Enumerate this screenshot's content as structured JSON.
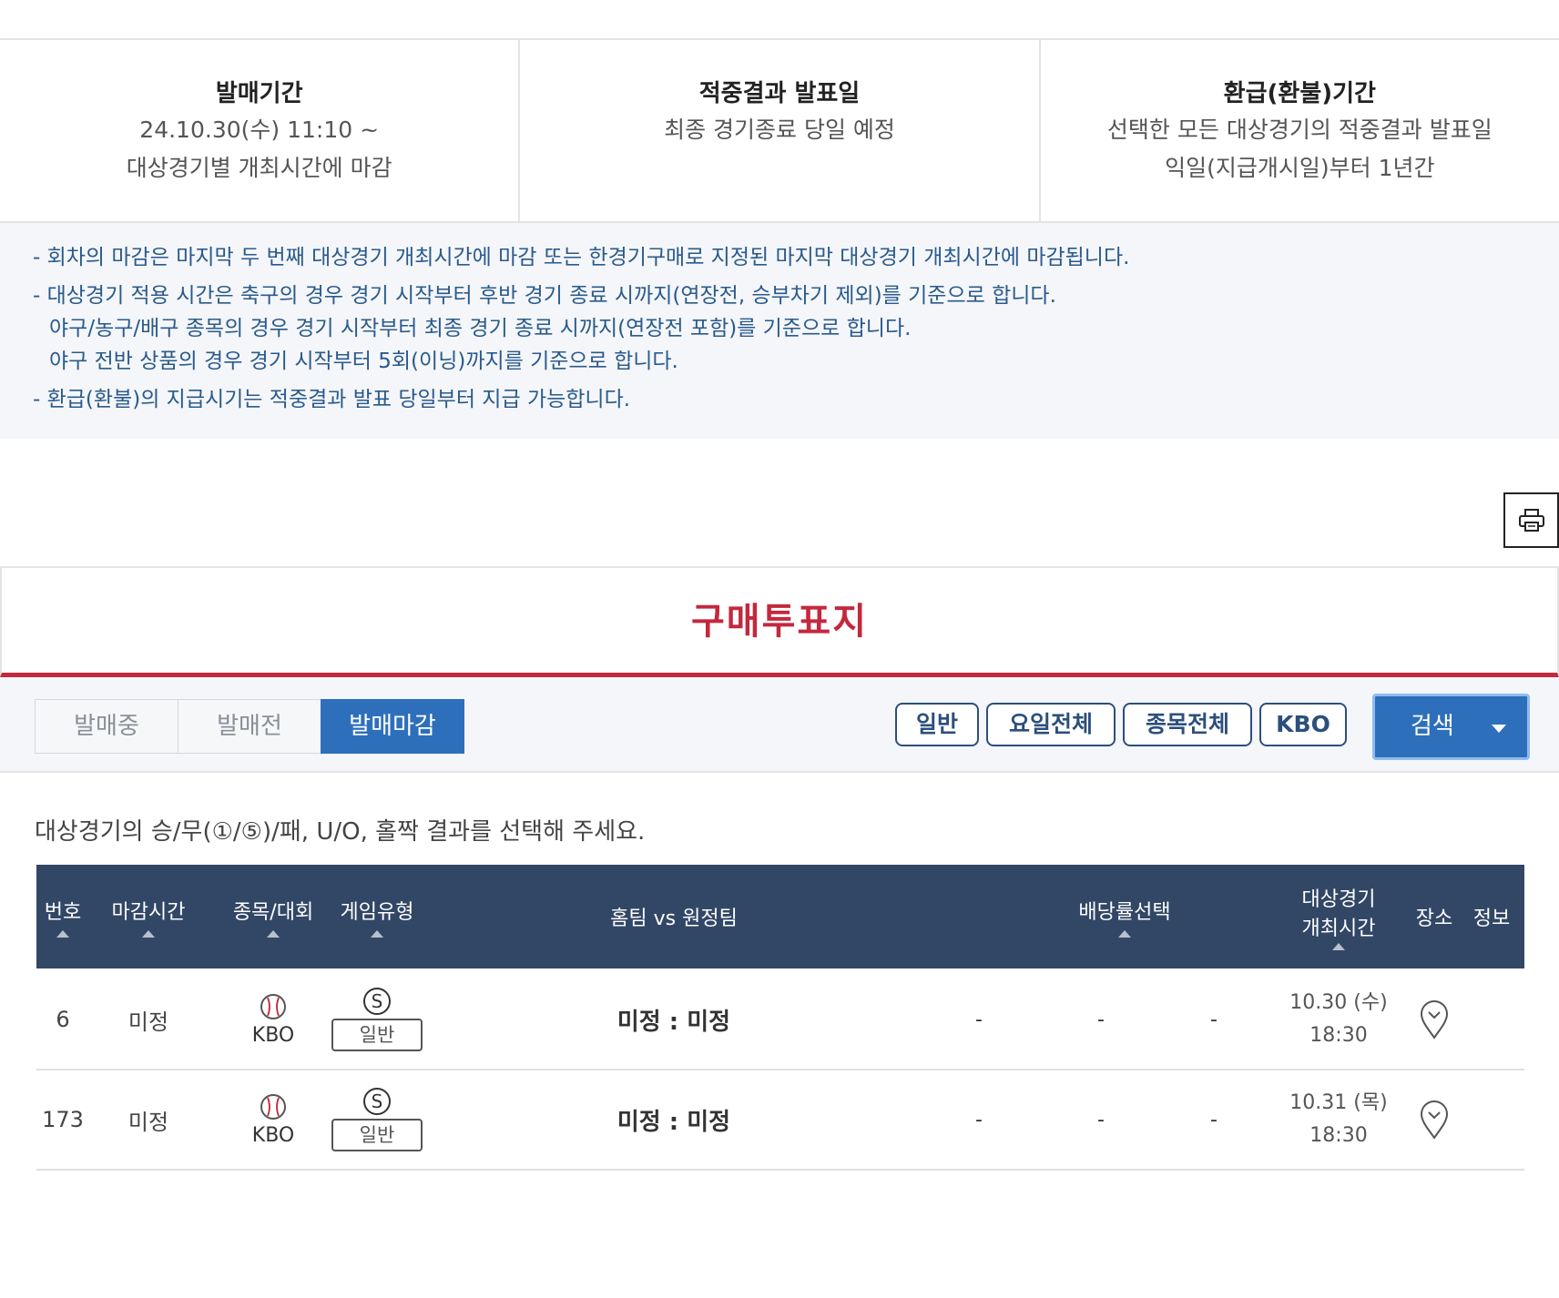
{
  "info": [
    {
      "title": "발매기간",
      "lines": [
        "24.10.30(수) 11:10 ~",
        "대상경기별 개최시간에 마감"
      ]
    },
    {
      "title": "적중결과 발표일",
      "lines": [
        "최종 경기종료 당일 예정"
      ]
    },
    {
      "title": "환급(환불)기간",
      "lines": [
        "선택한 모든 대상경기의 적중결과 발표일",
        "익일(지급개시일)부터 1년간"
      ]
    }
  ],
  "notes": [
    "- 회차의 마감은 마지막 두 번째 대상경기 개최시간에 마감 또는 한경기구매로 지정된 마지막 대상경기 개최시간에 마감됩니다.",
    "- 대상경기 적용 시간은 축구의 경우 경기 시작부터 후반 경기 종료 시까지(연장전, 승부차기 제외)를 기준으로 합니다.",
    "야구/농구/배구 종목의 경우 경기 시작부터 최종 경기 종료 시까지(연장전 포함)를 기준으로 합니다.",
    "야구 전반 상품의 경우 경기 시작부터 5회(이닝)까지를 기준으로 합니다.",
    "- 환급(환불)의 지급시기는 적중결과 발표 당일부터 지급 가능합니다."
  ],
  "page_title": "구매투표지",
  "tabs": [
    "발매중",
    "발매전",
    "발매마감"
  ],
  "active_tab": "발매마감",
  "filters": [
    "일반",
    "요일전체",
    "종목전체",
    "KBO"
  ],
  "search_label": "검색",
  "instruction": "대상경기의 승/무(①/⑤)/패, U/O, 홀짝 결과를 선택해 주세요.",
  "table": {
    "headers": {
      "no": "번호",
      "deadline": "마감시간",
      "sport": "종목/대회",
      "game_type": "게임유형",
      "teams": "홈팀 vs 원정팀",
      "odds": "배당률선택",
      "start_line1": "대상경기",
      "start_line2": "개최시간",
      "venue": "장소",
      "info": "정보"
    },
    "rows": [
      {
        "no": "6",
        "deadline": "미정",
        "league": "KBO",
        "badge": "S",
        "game_type": "일반",
        "home": "미정",
        "sep": ":",
        "away": "미정",
        "odds": [
          "-",
          "-",
          "-"
        ],
        "date": "10.30 (수)",
        "time": "18:30"
      },
      {
        "no": "173",
        "deadline": "미정",
        "league": "KBO",
        "badge": "S",
        "game_type": "일반",
        "home": "미정",
        "sep": ":",
        "away": "미정",
        "odds": [
          "-",
          "-",
          "-"
        ],
        "date": "10.31 (목)",
        "time": "18:30"
      }
    ]
  },
  "colors": {
    "accent_red": "#c4283d",
    "tab_active": "#2e6fbc",
    "table_header": "#324766",
    "note_text": "#2a5a8c"
  },
  "icons": [
    "printer-icon",
    "baseball-icon",
    "map-pin-icon",
    "sort-up-icon",
    "caret-down-icon"
  ]
}
